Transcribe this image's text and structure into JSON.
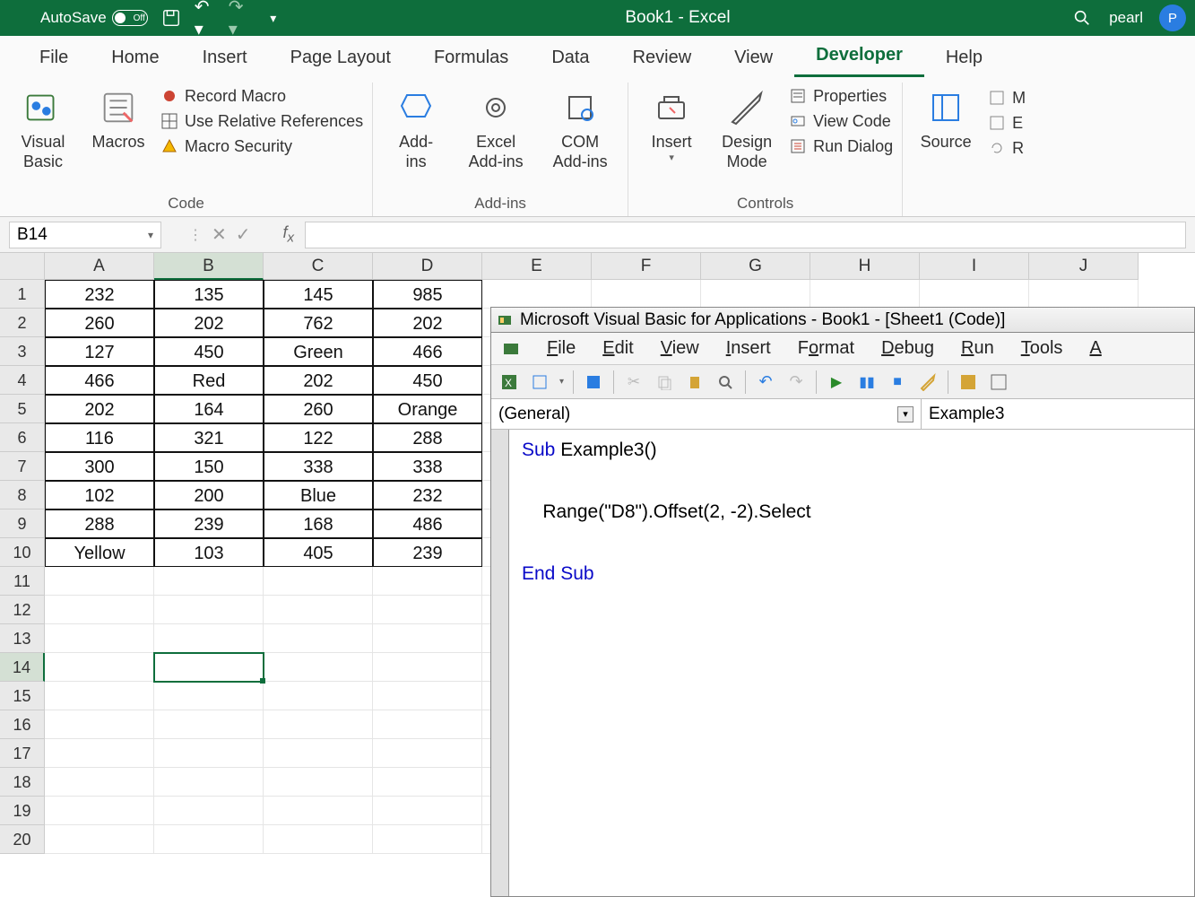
{
  "title_bar": {
    "autosave_label": "AutoSave",
    "autosave_state": "Off",
    "window_title": "Book1 - Excel",
    "user_name": "pearl",
    "user_initial": "P"
  },
  "tabs": [
    "File",
    "Home",
    "Insert",
    "Page Layout",
    "Formulas",
    "Data",
    "Review",
    "View",
    "Developer",
    "Help"
  ],
  "active_tab": "Developer",
  "ribbon": {
    "code": {
      "visual_basic": "Visual\nBasic",
      "macros": "Macros",
      "record_macro": "Record Macro",
      "use_relative": "Use Relative References",
      "macro_security": "Macro Security",
      "group_label": "Code"
    },
    "addins": {
      "addins": "Add-\nins",
      "excel_addins": "Excel\nAdd-ins",
      "com_addins": "COM\nAdd-ins",
      "group_label": "Add-ins"
    },
    "controls": {
      "insert": "Insert",
      "design_mode": "Design\nMode",
      "properties": "Properties",
      "view_code": "View Code",
      "run_dialog": "Run Dialog",
      "group_label": "Controls"
    },
    "xml": {
      "source": "Source"
    }
  },
  "namebox": "B14",
  "columns": [
    "A",
    "B",
    "C",
    "D",
    "E",
    "F",
    "G",
    "H",
    "I",
    "J"
  ],
  "selected_col": "B",
  "row_count": 20,
  "selected_row": 14,
  "cells": {
    "1": [
      "232",
      "135",
      "145",
      "985"
    ],
    "2": [
      "260",
      "202",
      "762",
      "202"
    ],
    "3": [
      "127",
      "450",
      "Green",
      "466"
    ],
    "4": [
      "466",
      "Red",
      "202",
      "450"
    ],
    "5": [
      "202",
      "164",
      "260",
      "Orange"
    ],
    "6": [
      "116",
      "321",
      "122",
      "288"
    ],
    "7": [
      "300",
      "150",
      "338",
      "338"
    ],
    "8": [
      "102",
      "200",
      "Blue",
      "232"
    ],
    "9": [
      "288",
      "239",
      "168",
      "486"
    ],
    "10": [
      "Yellow",
      "103",
      "405",
      "239"
    ]
  },
  "vba": {
    "title": "Microsoft Visual Basic for Applications - Book1 - [Sheet1 (Code)]",
    "menus": [
      "File",
      "Edit",
      "View",
      "Insert",
      "Format",
      "Debug",
      "Run",
      "Tools",
      "A"
    ],
    "dropdown_left": "(General)",
    "dropdown_right": "Example3",
    "code_kw_sub": "Sub",
    "code_subname": " Example3()",
    "code_body": "    Range(\"D8\").Offset(2, -2).Select",
    "code_kw_end": "End Sub"
  }
}
